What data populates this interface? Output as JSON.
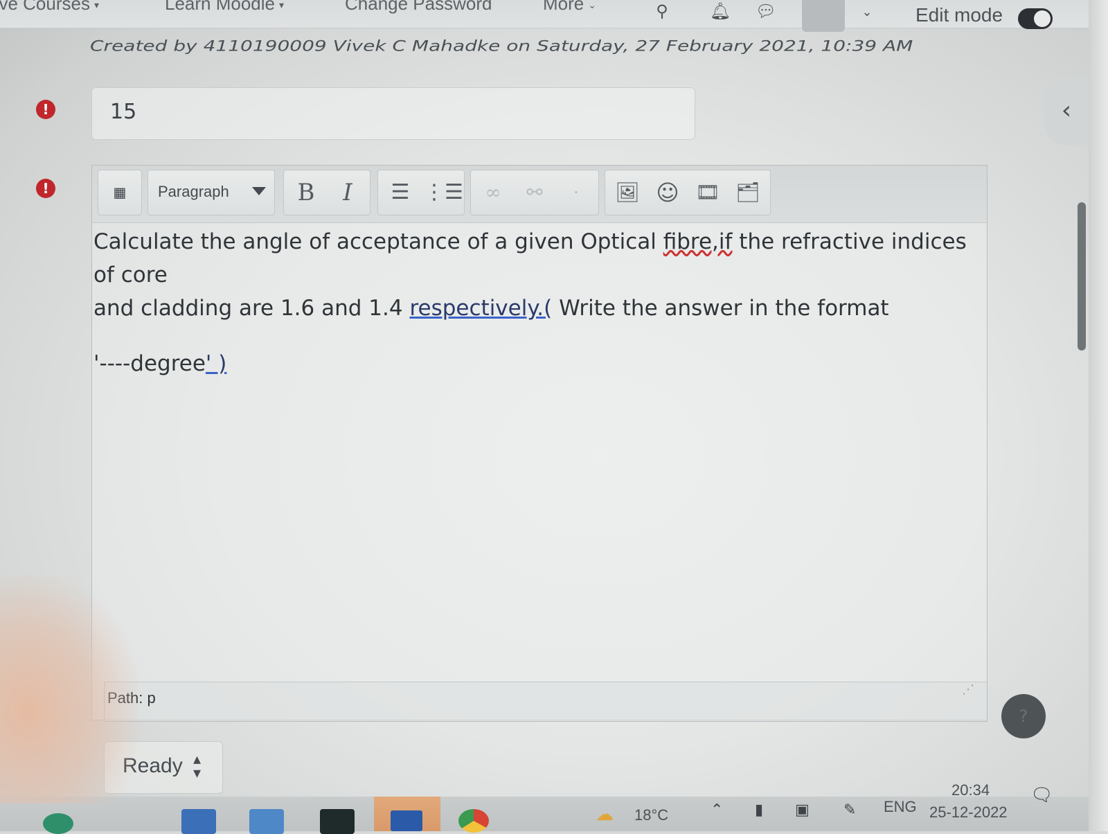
{
  "navbar": {
    "courses_fragment": "ove Courses",
    "learn_moodle": "Learn Moodle",
    "change_password": "Change Password",
    "more": "More",
    "edit_mode": "Edit mode"
  },
  "question": {
    "created_by": "Created by 4110190009 Vivek C Mahadke on Saturday, 27 February 2021, 10:39 AM",
    "mark_value": "15"
  },
  "editor": {
    "format_label": "Paragraph",
    "toolbar_icons": [
      "show-more-buttons-icon",
      "bold-icon",
      "italic-icon",
      "unordered-list-icon",
      "ordered-list-icon",
      "link-icon",
      "unlink-icon",
      "image-icon",
      "emoji-icon",
      "media-icon",
      "manage-files-icon"
    ],
    "bold_label": "B",
    "italic_label": "I",
    "line1_a": "Calculate the angle of acceptance of a given Optical ",
    "line1_b": "fibre,if",
    "line1_c": " the refractive indices of core",
    "line2_a": "and cladding are 1.6 and 1.4 ",
    "line2_b": "respectively.(",
    "line2_c": " Write the answer in the format",
    "line3_a": "'----degree",
    "line3_b": "' )",
    "path": "Path: p"
  },
  "status_select": {
    "selected": "Ready"
  },
  "taskbar": {
    "weather": "18°C",
    "language": "ENG",
    "time": "20:34",
    "date": "25-12-2022"
  },
  "colors": {
    "error": "#c0262b",
    "link_underline": "#3a63c9",
    "toggle": "#2c2f33"
  }
}
